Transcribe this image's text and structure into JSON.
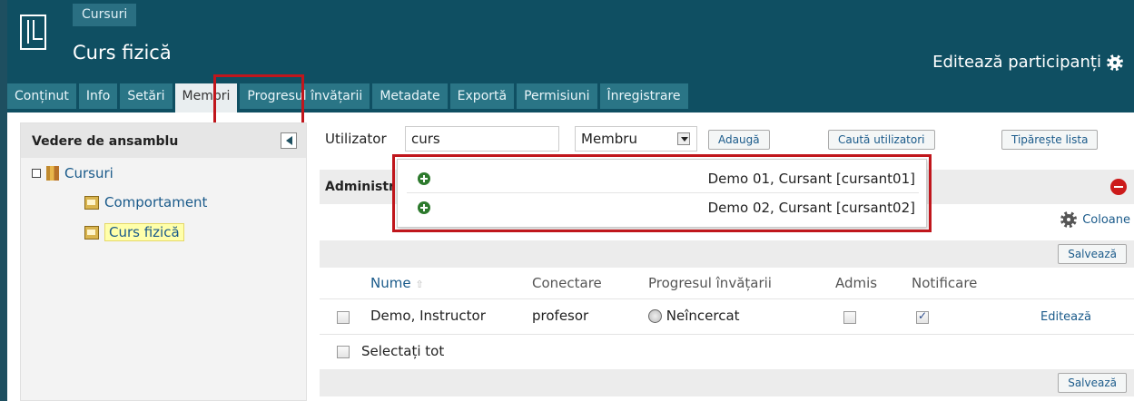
{
  "header": {
    "breadcrumb": "Cursuri",
    "title": "Curs fizică",
    "edit_participants": "Editează participanți"
  },
  "tabs": [
    {
      "label": "Conținut"
    },
    {
      "label": "Info"
    },
    {
      "label": "Setări"
    },
    {
      "label": "Membri"
    },
    {
      "label": "Progresul învățarii"
    },
    {
      "label": "Metadate"
    },
    {
      "label": "Exportă"
    },
    {
      "label": "Permisiuni"
    },
    {
      "label": "Înregistrare"
    }
  ],
  "sidebar": {
    "title": "Vedere de ansamblu",
    "tree": {
      "root": "Cursuri",
      "children": [
        "Comportament",
        "Curs fizică"
      ]
    }
  },
  "search": {
    "user_label": "Utilizator",
    "user_value": "curs",
    "role_value": "Membru",
    "add_button": "Adaugă",
    "search_users_button": "Caută utilizatori",
    "print_list_button": "Tipărește lista"
  },
  "autocomplete": {
    "items": [
      "Demo 01, Cursant [cursant01]",
      "Demo 02, Cursant [cursant02]"
    ]
  },
  "section": {
    "title": "Administr",
    "columns_link": "Coloane",
    "save_label": "Salvează"
  },
  "table": {
    "headers": {
      "name": "Nume",
      "login": "Conectare",
      "progress": "Progresul învățarii",
      "admitted": "Admis",
      "notification": "Notificare"
    },
    "rows": [
      {
        "name": "Demo, Instructor",
        "login": "profesor",
        "progress": "Neîncercat",
        "admitted": false,
        "notification": true,
        "edit": "Editează"
      }
    ],
    "select_all": "Selectați tot"
  },
  "colors": {
    "header_bg": "#0f4f62",
    "tab_bg": "#2a7586",
    "highlight_box": "#c0161c",
    "link": "#1a5a8a"
  }
}
